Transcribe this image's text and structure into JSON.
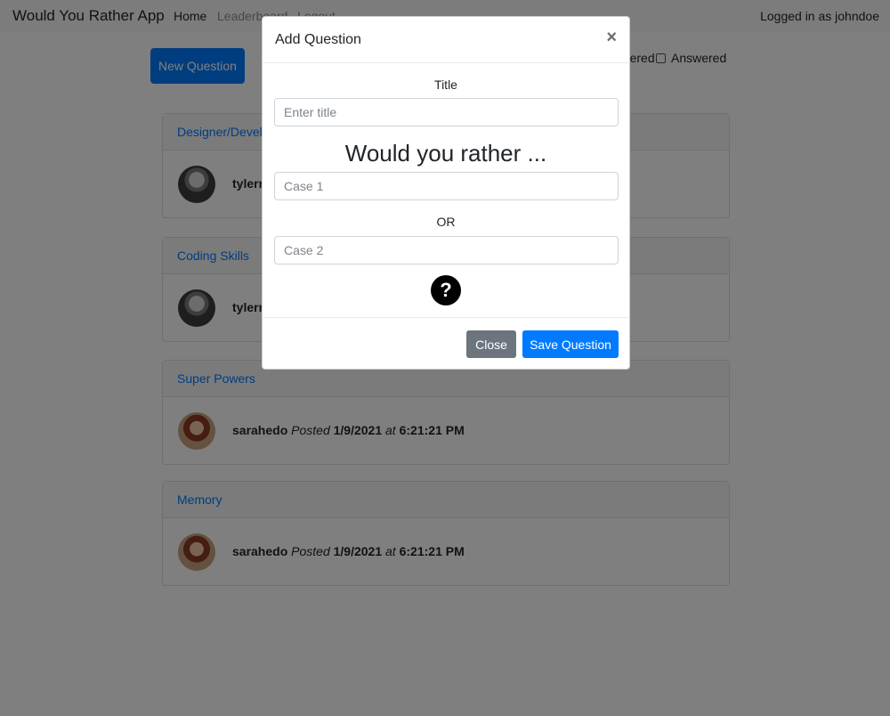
{
  "navbar": {
    "brand": "Would You Rather App",
    "links": [
      {
        "label": "Home"
      },
      {
        "label": "Leaderboard"
      },
      {
        "label": "Logout"
      }
    ],
    "logged_in_text": "Logged in as johndoe"
  },
  "main": {
    "new_question_label": "New Question",
    "filters": [
      {
        "label": "Unanswered",
        "checked": false
      },
      {
        "label": "Answered",
        "checked": false
      }
    ],
    "posted_label": "Posted",
    "at_label": "at",
    "questions": [
      {
        "title": "Designer/Developer",
        "author": "tylermcginnis",
        "avatar": "avatar-tyler",
        "date": "",
        "time": ""
      },
      {
        "title": "Coding Skills",
        "author": "tylermcginnis",
        "avatar": "avatar-tyler",
        "date": "",
        "time": ""
      },
      {
        "title": "Super Powers",
        "author": "sarahedo",
        "avatar": "avatar-sarah",
        "date": "1/9/2021",
        "time": "6:21:21 PM"
      },
      {
        "title": "Memory",
        "author": "sarahedo",
        "avatar": "avatar-sarah",
        "date": "1/9/2021",
        "time": "6:21:21 PM"
      }
    ]
  },
  "modal": {
    "title": "Add Question",
    "close_icon": "×",
    "title_label": "Title",
    "title_placeholder": "Enter title",
    "title_value": "",
    "heading": "Would you rather ...",
    "case1_placeholder": "Case 1",
    "case1_value": "",
    "or_label": "OR",
    "case2_placeholder": "Case 2",
    "case2_value": "",
    "help_icon": "?",
    "close_button": "Close",
    "save_button": "Save Question"
  },
  "colors": {
    "primary": "#007bff",
    "secondary": "#6c757d",
    "overlay": "rgba(0,0,0,0.5)"
  }
}
